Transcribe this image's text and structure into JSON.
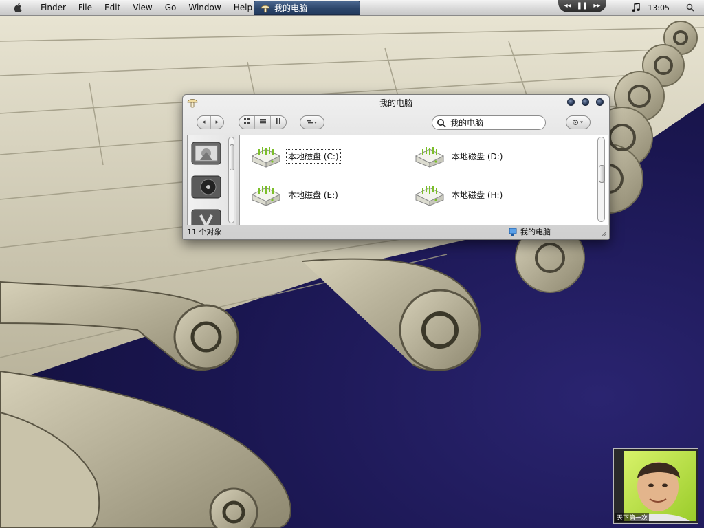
{
  "menubar": {
    "items": [
      "Finder",
      "File",
      "Edit",
      "View",
      "Go",
      "Window",
      "Help"
    ],
    "active_task": "我的电脑",
    "clock": "13:05",
    "media_prev": "◂◂",
    "media_pause": "❚❚",
    "media_next": "▸▸"
  },
  "window": {
    "title": "我的电脑",
    "search_value": "我的电脑",
    "drives": [
      {
        "label": "本地磁盘 (C:)"
      },
      {
        "label": "本地磁盘 (D:)"
      },
      {
        "label": "本地磁盘 (E:)"
      },
      {
        "label": "本地磁盘 (H:)"
      }
    ],
    "status_count": "11 个对象",
    "status_location": "我的电脑"
  },
  "album": {
    "caption": "天下第一次"
  },
  "colors": {
    "task_tab": "#2c456a",
    "wallpaper_deep": "#1a1650",
    "wallpaper_cream": "#d8d3bf"
  }
}
